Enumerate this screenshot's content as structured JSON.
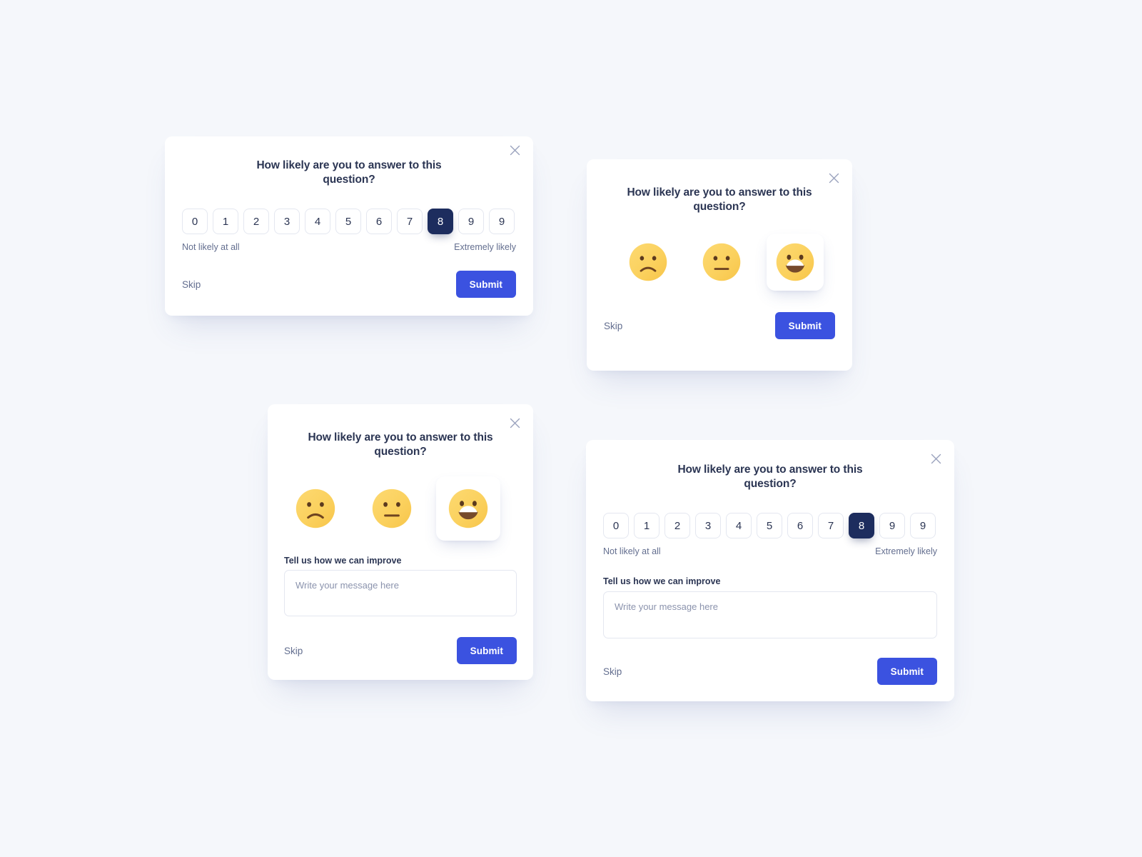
{
  "theme": {
    "page_background": "#f5f7fb",
    "card_background": "#ffffff",
    "title_color": "#2b3553",
    "muted_text_color": "#636e8f",
    "selected_scale_color": "#1d2d5e",
    "submit_color": "#3b52e0",
    "border_color": "#e4e7f0",
    "emoji_yellow": "#fbd25f",
    "emoji_mouth_brown": "#764a2b"
  },
  "common": {
    "question_title": "How likely are you to answer to this question?",
    "close_icon": "close-icon",
    "skip_label": "Skip",
    "submit_label": "Submit",
    "scale_values": [
      "0",
      "1",
      "2",
      "3",
      "4",
      "5",
      "6",
      "7",
      "8",
      "9",
      "9"
    ],
    "scale_selected_index": 8,
    "scale_selected_value": "8",
    "legend_low": "Not likely at all",
    "legend_high": "Extremely likely",
    "message_label": "Tell us how we can improve",
    "message_placeholder": "Write your message here",
    "message_value": "",
    "emoji_options": [
      {
        "name": "frowning-face-icon",
        "mood": "sad",
        "selected": false
      },
      {
        "name": "neutral-face-icon",
        "mood": "neutral",
        "selected": false
      },
      {
        "name": "grinning-face-icon",
        "mood": "happy",
        "selected": true
      }
    ],
    "emoji_selected_index": 2
  },
  "cards": [
    {
      "id": "card-scale",
      "variant": "number-scale",
      "title": "How likely are you to answer to this question?",
      "legend_low": "Not likely at all",
      "legend_high": "Extremely likely",
      "skip_label": "Skip",
      "submit_label": "Submit"
    },
    {
      "id": "card-emoji",
      "variant": "emoji-scale",
      "title": "How likely are you to answer to this question?",
      "skip_label": "Skip",
      "submit_label": "Submit"
    },
    {
      "id": "card-emoji-msg",
      "variant": "emoji-scale-with-message",
      "title": "How likely are you to answer to this question?",
      "message_label": "Tell us how we can improve",
      "message_placeholder": "Write your message here",
      "skip_label": "Skip",
      "submit_label": "Submit"
    },
    {
      "id": "card-scale-msg",
      "variant": "number-scale-with-message",
      "title": "How likely are you to answer to this question?",
      "legend_low": "Not likely at all",
      "legend_high": "Extremely likely",
      "message_label": "Tell us how we can improve",
      "message_placeholder": "Write your message here",
      "skip_label": "Skip",
      "submit_label": "Submit"
    }
  ]
}
